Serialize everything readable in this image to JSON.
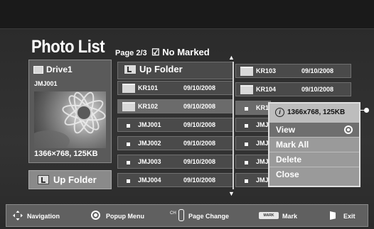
{
  "app": {
    "title": "Photo List"
  },
  "header": {
    "page_info": "Page 2/3",
    "no_marked": "☑ No Marked"
  },
  "left_panel": {
    "drive": "Drive1",
    "selected_name": "JMJ001",
    "resolution": "1366×768, 125KB",
    "up_folder_button": "Up Folder"
  },
  "list": {
    "col1": [
      {
        "type": "upfolder",
        "name": "Up Folder",
        "date": ""
      },
      {
        "type": "folder",
        "name": "KR101",
        "date": "09/10/2008"
      },
      {
        "type": "folder",
        "name": "KR102",
        "date": "09/10/2008"
      },
      {
        "type": "file",
        "name": "JMJ001",
        "date": "09/10/2008"
      },
      {
        "type": "file",
        "name": "JMJ002",
        "date": "09/10/2008"
      },
      {
        "type": "file",
        "name": "JMJ003",
        "date": "09/10/2008"
      },
      {
        "type": "file",
        "name": "JMJ004",
        "date": "09/10/2008"
      }
    ],
    "col2": [
      {
        "type": "folder",
        "name": "KR103",
        "date": "09/10/2008"
      },
      {
        "type": "folder",
        "name": "KR104",
        "date": "09/10/2008"
      },
      {
        "type": "file",
        "name": "KR1",
        "date": ""
      },
      {
        "type": "file",
        "name": "JMJ",
        "date": ""
      },
      {
        "type": "file",
        "name": "JMJ",
        "date": ""
      },
      {
        "type": "file",
        "name": "JMJ",
        "date": ""
      },
      {
        "type": "file",
        "name": "JMJ",
        "date": ""
      }
    ]
  },
  "popup": {
    "info_icon": "i",
    "info": "1366x768, 125KB",
    "items": [
      "View",
      "Mark All",
      "Delete",
      "Close"
    ],
    "selected": "View"
  },
  "bottom_bar": {
    "navigation": "Navigation",
    "popup_menu": "Popup Menu",
    "ch_label": "CH",
    "page_change": "Page Change",
    "mark_key": "MARK",
    "mark": "Mark",
    "exit": "Exit"
  },
  "icons": {
    "drive": "folder-icon",
    "navigation": "dpad-icon",
    "popup": "ok-circle-icon",
    "exit": "exit-icon"
  }
}
